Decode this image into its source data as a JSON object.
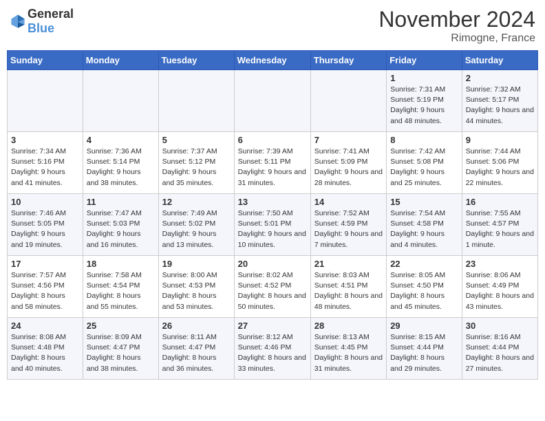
{
  "header": {
    "logo_general": "General",
    "logo_blue": "Blue",
    "month_title": "November 2024",
    "location": "Rimogne, France"
  },
  "weekdays": [
    "Sunday",
    "Monday",
    "Tuesday",
    "Wednesday",
    "Thursday",
    "Friday",
    "Saturday"
  ],
  "weeks": [
    [
      {
        "day": "",
        "info": ""
      },
      {
        "day": "",
        "info": ""
      },
      {
        "day": "",
        "info": ""
      },
      {
        "day": "",
        "info": ""
      },
      {
        "day": "",
        "info": ""
      },
      {
        "day": "1",
        "info": "Sunrise: 7:31 AM\nSunset: 5:19 PM\nDaylight: 9 hours and 48 minutes."
      },
      {
        "day": "2",
        "info": "Sunrise: 7:32 AM\nSunset: 5:17 PM\nDaylight: 9 hours and 44 minutes."
      }
    ],
    [
      {
        "day": "3",
        "info": "Sunrise: 7:34 AM\nSunset: 5:16 PM\nDaylight: 9 hours and 41 minutes."
      },
      {
        "day": "4",
        "info": "Sunrise: 7:36 AM\nSunset: 5:14 PM\nDaylight: 9 hours and 38 minutes."
      },
      {
        "day": "5",
        "info": "Sunrise: 7:37 AM\nSunset: 5:12 PM\nDaylight: 9 hours and 35 minutes."
      },
      {
        "day": "6",
        "info": "Sunrise: 7:39 AM\nSunset: 5:11 PM\nDaylight: 9 hours and 31 minutes."
      },
      {
        "day": "7",
        "info": "Sunrise: 7:41 AM\nSunset: 5:09 PM\nDaylight: 9 hours and 28 minutes."
      },
      {
        "day": "8",
        "info": "Sunrise: 7:42 AM\nSunset: 5:08 PM\nDaylight: 9 hours and 25 minutes."
      },
      {
        "day": "9",
        "info": "Sunrise: 7:44 AM\nSunset: 5:06 PM\nDaylight: 9 hours and 22 minutes."
      }
    ],
    [
      {
        "day": "10",
        "info": "Sunrise: 7:46 AM\nSunset: 5:05 PM\nDaylight: 9 hours and 19 minutes."
      },
      {
        "day": "11",
        "info": "Sunrise: 7:47 AM\nSunset: 5:03 PM\nDaylight: 9 hours and 16 minutes."
      },
      {
        "day": "12",
        "info": "Sunrise: 7:49 AM\nSunset: 5:02 PM\nDaylight: 9 hours and 13 minutes."
      },
      {
        "day": "13",
        "info": "Sunrise: 7:50 AM\nSunset: 5:01 PM\nDaylight: 9 hours and 10 minutes."
      },
      {
        "day": "14",
        "info": "Sunrise: 7:52 AM\nSunset: 4:59 PM\nDaylight: 9 hours and 7 minutes."
      },
      {
        "day": "15",
        "info": "Sunrise: 7:54 AM\nSunset: 4:58 PM\nDaylight: 9 hours and 4 minutes."
      },
      {
        "day": "16",
        "info": "Sunrise: 7:55 AM\nSunset: 4:57 PM\nDaylight: 9 hours and 1 minute."
      }
    ],
    [
      {
        "day": "17",
        "info": "Sunrise: 7:57 AM\nSunset: 4:56 PM\nDaylight: 8 hours and 58 minutes."
      },
      {
        "day": "18",
        "info": "Sunrise: 7:58 AM\nSunset: 4:54 PM\nDaylight: 8 hours and 55 minutes."
      },
      {
        "day": "19",
        "info": "Sunrise: 8:00 AM\nSunset: 4:53 PM\nDaylight: 8 hours and 53 minutes."
      },
      {
        "day": "20",
        "info": "Sunrise: 8:02 AM\nSunset: 4:52 PM\nDaylight: 8 hours and 50 minutes."
      },
      {
        "day": "21",
        "info": "Sunrise: 8:03 AM\nSunset: 4:51 PM\nDaylight: 8 hours and 48 minutes."
      },
      {
        "day": "22",
        "info": "Sunrise: 8:05 AM\nSunset: 4:50 PM\nDaylight: 8 hours and 45 minutes."
      },
      {
        "day": "23",
        "info": "Sunrise: 8:06 AM\nSunset: 4:49 PM\nDaylight: 8 hours and 43 minutes."
      }
    ],
    [
      {
        "day": "24",
        "info": "Sunrise: 8:08 AM\nSunset: 4:48 PM\nDaylight: 8 hours and 40 minutes."
      },
      {
        "day": "25",
        "info": "Sunrise: 8:09 AM\nSunset: 4:47 PM\nDaylight: 8 hours and 38 minutes."
      },
      {
        "day": "26",
        "info": "Sunrise: 8:11 AM\nSunset: 4:47 PM\nDaylight: 8 hours and 36 minutes."
      },
      {
        "day": "27",
        "info": "Sunrise: 8:12 AM\nSunset: 4:46 PM\nDaylight: 8 hours and 33 minutes."
      },
      {
        "day": "28",
        "info": "Sunrise: 8:13 AM\nSunset: 4:45 PM\nDaylight: 8 hours and 31 minutes."
      },
      {
        "day": "29",
        "info": "Sunrise: 8:15 AM\nSunset: 4:44 PM\nDaylight: 8 hours and 29 minutes."
      },
      {
        "day": "30",
        "info": "Sunrise: 8:16 AM\nSunset: 4:44 PM\nDaylight: 8 hours and 27 minutes."
      }
    ]
  ]
}
